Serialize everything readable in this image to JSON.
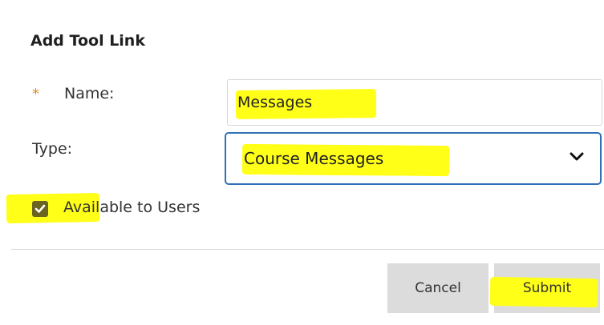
{
  "dialog": {
    "title": "Add Tool Link"
  },
  "form": {
    "name": {
      "required_marker": "*",
      "label": "Name:",
      "value": "Messages"
    },
    "type": {
      "label": "Type:",
      "selected": "Course Messages"
    },
    "available": {
      "label": "Available to Users",
      "checked": true
    }
  },
  "buttons": {
    "cancel": "Cancel",
    "submit": "Submit"
  },
  "colors": {
    "highlight": "#ffff18",
    "focus_border": "#2e6fb8",
    "required": "#e08a1e",
    "checkbox": "#6b6420",
    "button_bg": "#dcdcdc"
  }
}
